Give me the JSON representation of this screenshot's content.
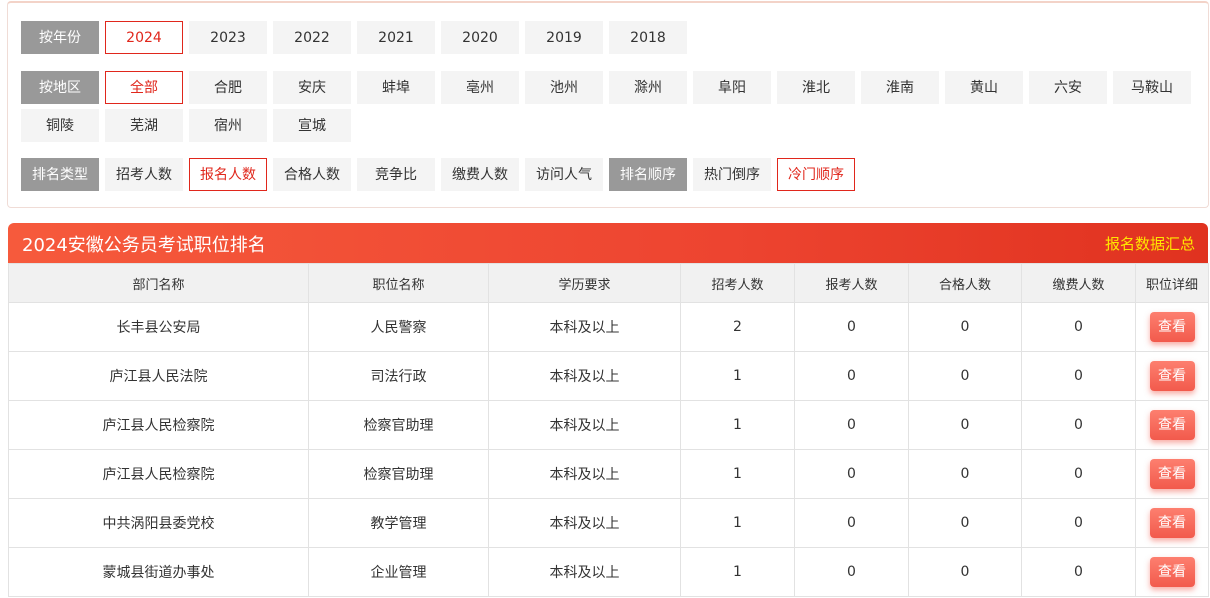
{
  "filters": {
    "year_label": "按年份",
    "years": [
      {
        "label": "2024",
        "active": true
      },
      {
        "label": "2023",
        "active": false
      },
      {
        "label": "2022",
        "active": false
      },
      {
        "label": "2021",
        "active": false
      },
      {
        "label": "2020",
        "active": false
      },
      {
        "label": "2019",
        "active": false
      },
      {
        "label": "2018",
        "active": false
      }
    ],
    "region_label": "按地区",
    "regions_row1": [
      {
        "label": "全部",
        "active": true
      },
      {
        "label": "合肥",
        "active": false
      },
      {
        "label": "安庆",
        "active": false
      },
      {
        "label": "蚌埠",
        "active": false
      },
      {
        "label": "亳州",
        "active": false
      },
      {
        "label": "池州",
        "active": false
      },
      {
        "label": "滁州",
        "active": false
      },
      {
        "label": "阜阳",
        "active": false
      },
      {
        "label": "淮北",
        "active": false
      },
      {
        "label": "淮南",
        "active": false
      },
      {
        "label": "黄山",
        "active": false
      },
      {
        "label": "六安",
        "active": false
      },
      {
        "label": "马鞍山",
        "active": false
      }
    ],
    "regions_row2": [
      {
        "label": "铜陵",
        "active": false
      },
      {
        "label": "芜湖",
        "active": false
      },
      {
        "label": "宿州",
        "active": false
      },
      {
        "label": "宣城",
        "active": false
      }
    ],
    "rank_type_label": "排名类型",
    "rank_types": [
      {
        "label": "招考人数",
        "active": false
      },
      {
        "label": "报名人数",
        "active": true
      },
      {
        "label": "合格人数",
        "active": false
      },
      {
        "label": "竞争比",
        "active": false
      },
      {
        "label": "缴费人数",
        "active": false
      },
      {
        "label": "访问人气",
        "active": false
      }
    ],
    "rank_order_label": "排名顺序",
    "rank_orders": [
      {
        "label": "热门倒序",
        "active": false
      },
      {
        "label": "冷门顺序",
        "active": true
      }
    ]
  },
  "ranking": {
    "title": "2024安徽公务员考试职位排名",
    "summary_link": "报名数据汇总",
    "columns": [
      "部门名称",
      "职位名称",
      "学历要求",
      "招考人数",
      "报考人数",
      "合格人数",
      "缴费人数",
      "职位详细"
    ],
    "view_label": "查看",
    "rows": [
      [
        "长丰县公安局",
        "人民警察",
        "本科及以上",
        "2",
        "0",
        "0",
        "0"
      ],
      [
        "庐江县人民法院",
        "司法行政",
        "本科及以上",
        "1",
        "0",
        "0",
        "0"
      ],
      [
        "庐江县人民检察院",
        "检察官助理",
        "本科及以上",
        "1",
        "0",
        "0",
        "0"
      ],
      [
        "庐江县人民检察院",
        "检察官助理",
        "本科及以上",
        "1",
        "0",
        "0",
        "0"
      ],
      [
        "中共涡阳县委党校",
        "教学管理",
        "本科及以上",
        "1",
        "0",
        "0",
        "0"
      ],
      [
        "蒙城县街道办事处",
        "企业管理",
        "本科及以上",
        "1",
        "0",
        "0",
        "0"
      ]
    ]
  },
  "colors": {
    "accent": "#e0271c",
    "title_gradient_start": "#f65a3c",
    "title_gradient_end": "#e0321f",
    "summary_link": "#ffe600",
    "label_bg": "#999999",
    "button": "#f25a4c"
  }
}
